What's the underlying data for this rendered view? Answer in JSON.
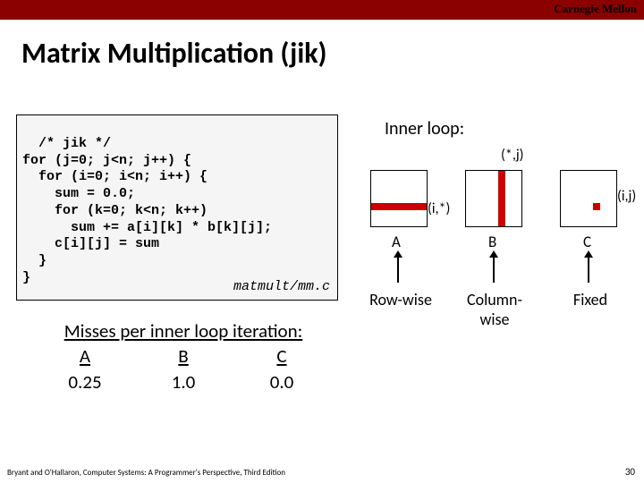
{
  "header": {
    "brand": "Carnegie Mellon"
  },
  "title": "Matrix Multiplication (jik)",
  "code": {
    "lines": "/* jik */\nfor (j=0; j<n; j++) {\n  for (i=0; i<n; i++) {\n    sum = 0.0;\n    for (k=0; k<n; k++)\n      sum += a[i][k] * b[k][j];\n    c[i][j] = sum\n  }\n}",
    "source_file": "matmult/mm.c"
  },
  "inner_loop_label": "Inner loop:",
  "matrices": {
    "A": {
      "name": "A",
      "index_label": "(i,*)",
      "access": "Row-wise"
    },
    "B": {
      "name": "B",
      "index_label": "(*,j)",
      "access": "Column-wise"
    },
    "C": {
      "name": "C",
      "index_label": "(i,j)",
      "access": "Fixed"
    }
  },
  "misses": {
    "heading": "Misses per inner loop iteration:",
    "cols": [
      "A",
      "B",
      "C"
    ],
    "vals": [
      "0.25",
      "1.0",
      "0.0"
    ]
  },
  "footer": "Bryant and O'Hallaron, Computer Systems: A Programmer's Perspective, Third Edition",
  "page_number": "30"
}
